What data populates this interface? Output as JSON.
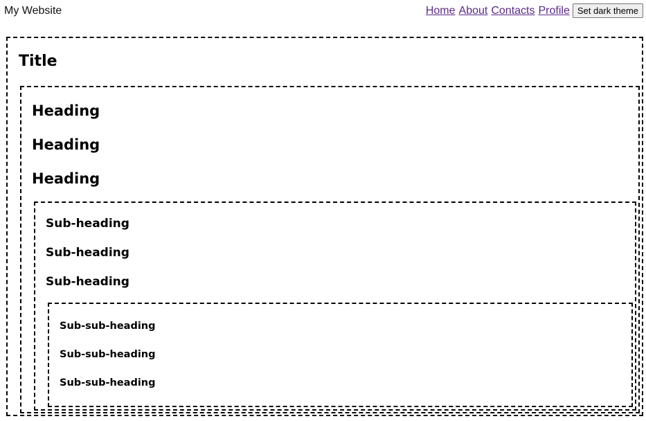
{
  "header": {
    "site_name": "My Website",
    "nav": [
      "Home",
      "About",
      "Contacts",
      "Profile"
    ],
    "theme_button": "Set dark theme"
  },
  "content": {
    "title": "Title",
    "headings": [
      "Heading",
      "Heading",
      "Heading"
    ],
    "subheadings": [
      "Sub-heading",
      "Sub-heading",
      "Sub-heading"
    ],
    "subsubheadings": [
      "Sub-sub-heading",
      "Sub-sub-heading",
      "Sub-sub-heading"
    ]
  },
  "colors": {
    "link": "#5b2a86",
    "border": "#000000",
    "background": "#ffffff"
  }
}
